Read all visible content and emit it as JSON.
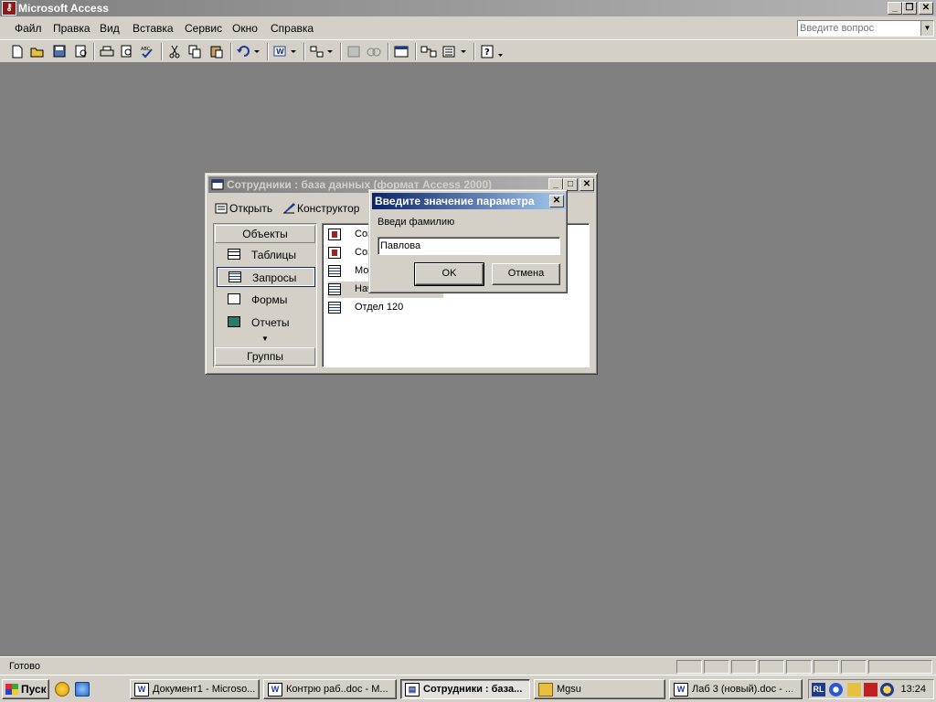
{
  "app": {
    "title": "Microsoft Access"
  },
  "menu": {
    "items": [
      "Файл",
      "Правка",
      "Вид",
      "Вставка",
      "Сервис",
      "Окно",
      "Справка"
    ]
  },
  "help_box": {
    "placeholder": "Введите вопрос"
  },
  "db_window": {
    "title": "Сотрудники : база данных (формат Access 2000)",
    "toolbar": {
      "open_label": "Открыть",
      "design_label": "Конструктор"
    },
    "objects_header": "Объекты",
    "groups_header": "Группы",
    "objects": [
      "Таблицы",
      "Запросы",
      "Формы",
      "Отчеты"
    ],
    "selected_object": "Запросы",
    "items": [
      "Соз",
      "Соз",
      "Мор",
      "Нач",
      "Отдел 120"
    ]
  },
  "param_dialog": {
    "title": "Введите значение параметра",
    "prompt": "Введи фамилию",
    "value": "Павлова",
    "ok_label": "OK",
    "cancel_label": "Отмена"
  },
  "status": {
    "text": "Готово"
  },
  "taskbar": {
    "start_label": "Пуск",
    "tasks": [
      "Документ1 - Microso...",
      "Контрю раб..doc - M...",
      "Сотрудники : база...",
      "Mgsu",
      "Лаб 3 (новый).doc - ..."
    ],
    "active_task": "Сотрудники : база...",
    "clock": "13:24",
    "lang": "RL"
  },
  "colors": {
    "active_title": "#0a246a",
    "inactive_title": "#808080",
    "workspace": "#808080",
    "face": "#d4d0c8"
  }
}
